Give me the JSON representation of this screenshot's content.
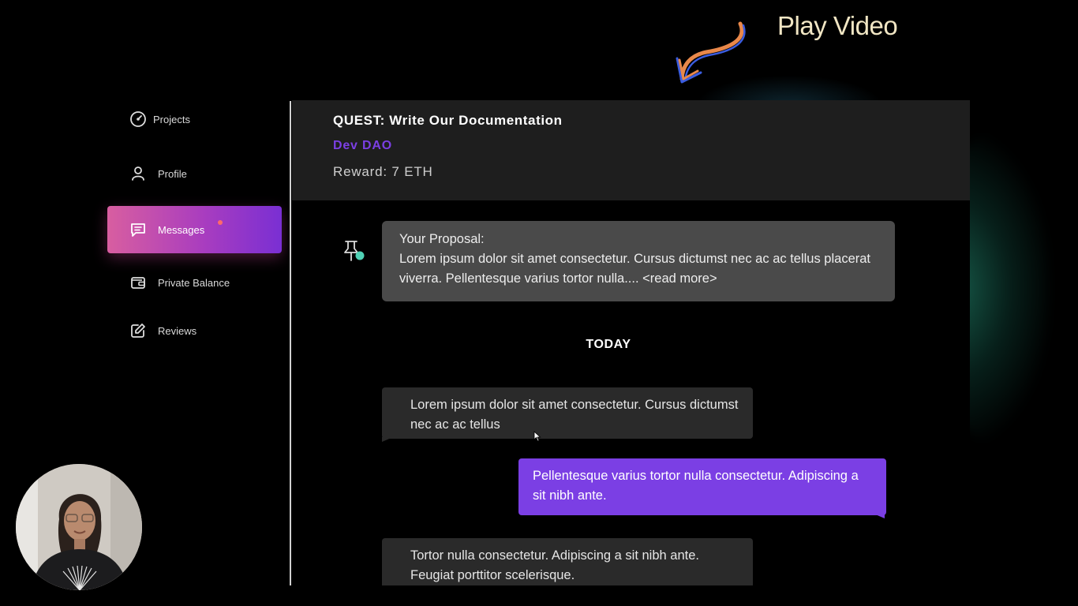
{
  "overlay": {
    "play_video": "Play Video"
  },
  "sidebar": {
    "items": [
      {
        "label": "Projects",
        "icon": "dashboard-gauge-icon"
      },
      {
        "label": "Profile",
        "icon": "user-icon"
      },
      {
        "label": "Messages",
        "icon": "chat-icon",
        "active": true,
        "has_notification": true
      },
      {
        "label": "Private Balance",
        "icon": "wallet-icon"
      },
      {
        "label": "Reviews",
        "icon": "edit-icon"
      }
    ]
  },
  "header": {
    "quest_title": "QUEST: Write Our Documentation",
    "dao_name": "Dev DAO",
    "reward": "Reward: 7 ETH"
  },
  "chat": {
    "pinned": {
      "title": "Your Proposal:",
      "body": "Lorem ipsum dolor sit amet consectetur. Cursus dictumst nec ac ac tellus placerat viverra. Pellentesque varius tortor nulla.... <read more>"
    },
    "date_divider": "TODAY",
    "messages": [
      {
        "direction": "incoming",
        "text": "Lorem ipsum dolor sit amet consectetur. Cursus dictumst nec ac ac tellus"
      },
      {
        "direction": "outgoing",
        "text": "Pellentesque varius tortor nulla consectetur. Adipiscing a sit nibh ante."
      },
      {
        "direction": "incoming",
        "text": "Tortor nulla consectetur. Adipiscing a sit nibh ante. Feugiat porttitor scelerisque."
      }
    ]
  },
  "colors": {
    "accent_purple": "#7b3fe4",
    "active_gradient_start": "#d85ea0",
    "active_gradient_end": "#7a2fd3",
    "notification_dot": "#ff6a6a",
    "pin_accent": "#4fd1b5"
  }
}
